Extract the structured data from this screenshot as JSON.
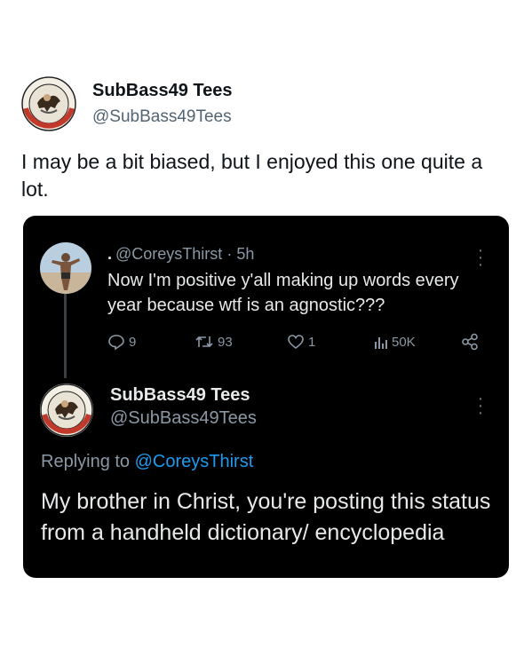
{
  "outer_tweet": {
    "display_name": "SubBass49 Tees",
    "handle": "@SubBass49Tees",
    "text": "I may be a bit biased, but I enjoyed this one quite a lot.",
    "avatar_ring_text": "INGLOURIOUS BASTERDS"
  },
  "embedded": {
    "original": {
      "lead_dot": ".",
      "handle": "@CoreysThirst",
      "separator": "·",
      "time": "5h",
      "text": "Now I'm positive y'all making up words every year because wtf is an agnostic???",
      "stats": {
        "replies": "9",
        "retweets": "93",
        "likes": "1",
        "views": "50K"
      }
    },
    "reply": {
      "display_name": "SubBass49 Tees",
      "handle": "@SubBass49Tees",
      "replying_prefix": "Replying to",
      "replying_to": "@CoreysThirst",
      "text": "My brother in Christ, you're posting this status from a handheld dictionary/ encyclopedia"
    }
  },
  "icons": [
    "avatar-subbass-icon",
    "avatar-corey-icon",
    "more-icon",
    "reply-icon",
    "retweet-icon",
    "like-icon",
    "views-icon",
    "share-icon"
  ],
  "colors": {
    "card_bg": "#000000",
    "text_light": "#e7e9ea",
    "text_muted": "#8b98a5",
    "link": "#1d9bf0",
    "text_dark": "#0f1419",
    "handle_gray": "#536471"
  }
}
